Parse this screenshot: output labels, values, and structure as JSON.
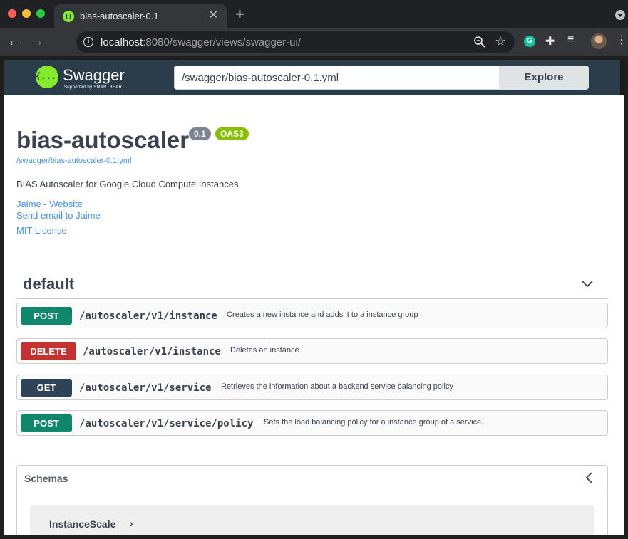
{
  "browser": {
    "tab_title": "bias-autoscaler-0.1",
    "tab_close": "✕",
    "new_tab": "+",
    "url_host": "localhost",
    "url_rest": ":8080/swagger/views/swagger-ui/",
    "icons": [
      "back-arrow-icon",
      "forward-arrow-icon",
      "info-icon",
      "zoom-icon",
      "bookmark-star-icon",
      "grammarly-icon",
      "extensions-puzzle-icon",
      "media-control-icon",
      "profile-avatar",
      "tab-search-icon"
    ]
  },
  "swagger_topbar": {
    "brand": "Swagger",
    "brand_sub": "Supported by SMARTBEAR",
    "spec_url_value": "/swagger/bias-autoscaler-0.1.yml",
    "explore_label": "Explore",
    "logo_glyph": "{...}",
    "brand_color": "#85ea2d",
    "topbar_color": "#2b3d4a"
  },
  "info": {
    "title": "bias-autoscaler",
    "version": "0.1",
    "oas_badge": "OAS3",
    "spec_link": "/swagger/bias-autoscaler-0.1.yml",
    "description": "BIAS Autoscaler for Google Cloud Compute Instances",
    "website_link": "Jaime - Website",
    "email_link": "Send email to Jaime",
    "license_link": "MIT License"
  },
  "tag": {
    "name": "default",
    "expanded": true
  },
  "operations": [
    {
      "method": "POST",
      "color": "#49cc90",
      "badge_color": "#10866b",
      "path": "/autoscaler/v1/instance",
      "summary": "Creates a new instance and adds it to a instance group"
    },
    {
      "method": "DELETE",
      "color": "#f93e3e",
      "badge_color": "#c53030",
      "path": "/autoscaler/v1/instance",
      "summary": "Deletes an instance"
    },
    {
      "method": "GET",
      "color": "#61affe",
      "badge_color": "#2f4358",
      "path": "/autoscaler/v1/service",
      "summary": "Retrieves the information about a backend service balancing policy"
    },
    {
      "method": "POST",
      "color": "#49cc90",
      "badge_color": "#10866b",
      "path": "/autoscaler/v1/service/policy",
      "summary": "Sets the load balancing policy for a instance group of a service."
    }
  ],
  "schemas": {
    "title": "Schemas",
    "items": [
      {
        "name": "InstanceScale",
        "arrow": "›"
      }
    ]
  }
}
